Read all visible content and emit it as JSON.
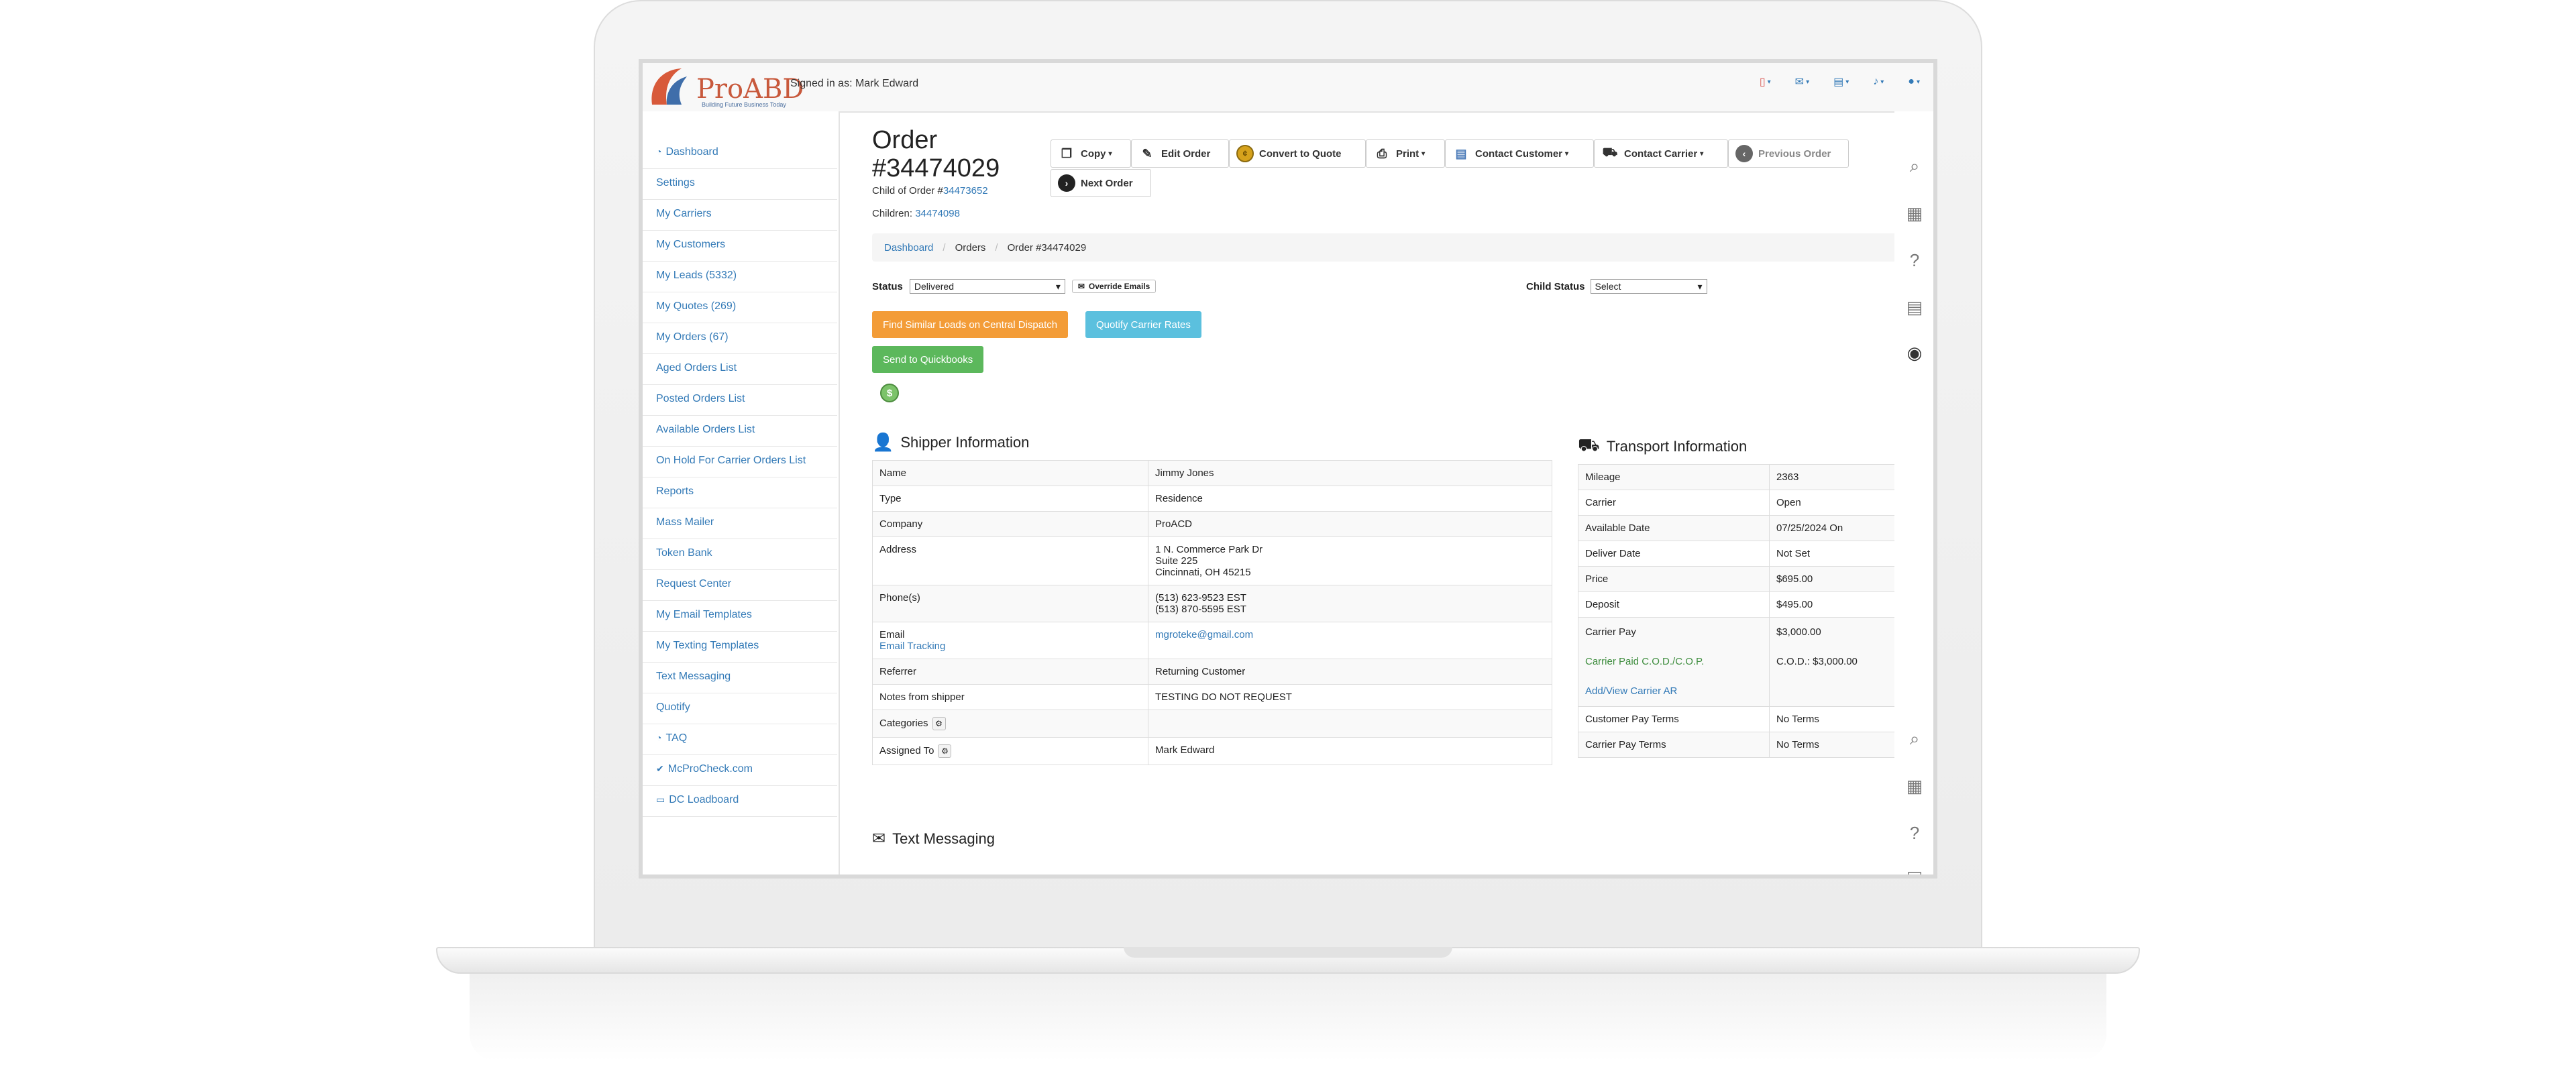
{
  "topbar": {
    "logo_text": "ProABD",
    "logo_tagline": "Building Future Business Today",
    "signed_in": "Signed in as: Mark Edward",
    "icons": [
      "mobile-icon",
      "envelope-icon",
      "table-icon",
      "bell-icon",
      "user-icon"
    ]
  },
  "sidebar": {
    "items": [
      {
        "label": "Dashboard",
        "icon": "dashboard-icon"
      },
      {
        "label": "Settings"
      },
      {
        "label": "My Carriers"
      },
      {
        "label": "My Customers"
      },
      {
        "label": "My Leads (5332)"
      },
      {
        "label": "My Quotes (269)"
      },
      {
        "label": "My Orders (67)"
      },
      {
        "label": "Aged Orders List"
      },
      {
        "label": "Posted Orders List"
      },
      {
        "label": "Available Orders List"
      },
      {
        "label": "On Hold For Carrier Orders List"
      },
      {
        "label": "Reports"
      },
      {
        "label": "Mass Mailer"
      },
      {
        "label": "Token Bank"
      },
      {
        "label": "Request Center"
      },
      {
        "label": "My Email Templates"
      },
      {
        "label": "My Texting Templates"
      },
      {
        "label": "Text Messaging"
      },
      {
        "label": "Quotify"
      },
      {
        "label": "TAQ",
        "icon": "dashboard-icon"
      },
      {
        "label": "McProCheck.com",
        "icon": "check-icon"
      },
      {
        "label": "DC Loadboard",
        "icon": "truck-icon"
      }
    ]
  },
  "order": {
    "title_line1": "Order",
    "title_line2": "#34474029",
    "child_of_prefix": "Child of Order #",
    "child_of_number": "34473652",
    "children_prefix": "Children: ",
    "children_number": "34474098"
  },
  "toolbar": {
    "copy": "Copy",
    "edit": "Edit Order",
    "convert": "Convert to Quote",
    "print": "Print",
    "contact_customer": "Contact Customer",
    "contact_carrier": "Contact Carrier",
    "previous": "Previous Order",
    "next": "Next Order"
  },
  "breadcrumb": {
    "dashboard": "Dashboard",
    "orders": "Orders",
    "current": "Order #34474029"
  },
  "status": {
    "label": "Status",
    "value": "Delivered",
    "override": "Override Emails",
    "child_label": "Child Status",
    "child_value": "Select"
  },
  "actions": {
    "central_dispatch": "Find Similar Loads on Central Dispatch",
    "quotify": "Quotify Carrier Rates",
    "quickbooks": "Send to Quickbooks",
    "dollar": "$"
  },
  "shipper": {
    "heading": "Shipper Information",
    "rows": {
      "name_label": "Name",
      "name": "Jimmy Jones",
      "type_label": "Type",
      "type": "Residence",
      "company_label": "Company",
      "company": "ProACD",
      "address_label": "Address",
      "address1": "1 N. Commerce Park Dr",
      "address2": "Suite 225",
      "address3": "Cincinnati, OH 45215",
      "phone_label": "Phone(s)",
      "phone1": "(513) 623-9523 EST",
      "phone2": "(513) 870-5595 EST",
      "email_label": "Email",
      "email_tracking": "Email Tracking",
      "email": "mgroteke@gmail.com",
      "referrer_label": "Referrer",
      "referrer": "Returning Customer",
      "notes_label": "Notes from shipper",
      "notes": "TESTING DO NOT REQUEST",
      "categories_label": "Categories",
      "assigned_label": "Assigned To",
      "assigned": "Mark Edward"
    }
  },
  "transport": {
    "heading": "Transport Information",
    "rows": {
      "mileage_label": "Mileage",
      "mileage": "2363",
      "carrier_label": "Carrier",
      "carrier": "Open",
      "available_label": "Available Date",
      "available": "07/25/2024 On",
      "deliver_label": "Deliver Date",
      "deliver": "Not Set",
      "price_label": "Price",
      "price": "$695.00",
      "deposit_label": "Deposit",
      "deposit": "$495.00",
      "carrier_pay_label": "Carrier Pay",
      "carrier_pay": "$3,000.00",
      "carrier_paid_label": "Carrier Paid C.O.D./C.O.P.",
      "carrier_paid": "C.O.D.: $3,000.00",
      "add_view_ar": "Add/View Carrier AR",
      "customer_terms_label": "Customer Pay Terms",
      "customer_terms": "No Terms",
      "carrier_terms_label": "Carrier Pay Terms",
      "carrier_terms": "No Terms"
    }
  },
  "text_messaging": {
    "heading": "Text Messaging"
  },
  "rail_icons": [
    "search-icon",
    "grid-icon",
    "help-icon",
    "calculator-icon",
    "eye-icon"
  ]
}
